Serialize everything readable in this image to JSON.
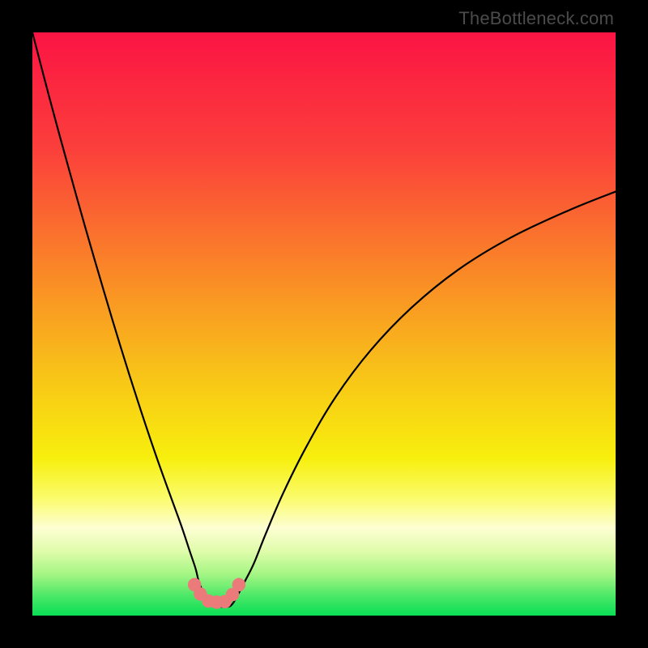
{
  "watermark": "TheBottleneck.com",
  "chart_data": {
    "type": "line",
    "title": "",
    "xlabel": "",
    "ylabel": "",
    "xlim": [
      0,
      100
    ],
    "ylim": [
      0,
      100
    ],
    "background_gradient": {
      "stops": [
        {
          "offset": 0,
          "color": "#fb1444"
        },
        {
          "offset": 20,
          "color": "#fb3f3b"
        },
        {
          "offset": 40,
          "color": "#fa8428"
        },
        {
          "offset": 60,
          "color": "#f8c817"
        },
        {
          "offset": 73,
          "color": "#f7ef0d"
        },
        {
          "offset": 80,
          "color": "#fbfc6e"
        },
        {
          "offset": 85,
          "color": "#fdfed3"
        },
        {
          "offset": 89,
          "color": "#dffcaa"
        },
        {
          "offset": 93,
          "color": "#a3f583"
        },
        {
          "offset": 96.5,
          "color": "#4ee868"
        },
        {
          "offset": 100,
          "color": "#09de55"
        }
      ]
    },
    "series": [
      {
        "name": "bottleneck-curve",
        "x": [
          0,
          3,
          6,
          9,
          12,
          15,
          18,
          21,
          23.5,
          25.5,
          27,
          28,
          28.5,
          29.4,
          30.5,
          32,
          33.5,
          34.3,
          35.2,
          36.5,
          38,
          40,
          43,
          47,
          52,
          58,
          65,
          73,
          82,
          92,
          100
        ],
        "y": [
          100,
          88.5,
          77.5,
          66.8,
          56.5,
          46.5,
          37,
          28,
          21,
          15.5,
          11,
          8,
          6,
          3.8,
          2.5,
          1.6,
          1.5,
          2,
          3.5,
          6,
          9,
          14,
          21,
          29,
          37.5,
          45.5,
          52.8,
          59.3,
          64.8,
          69.5,
          72.7
        ]
      }
    ],
    "markers": {
      "name": "valley-dots",
      "color": "#eb7b7b",
      "radius_pct": 1.15,
      "points": [
        {
          "x": 27.8,
          "y": 5.3
        },
        {
          "x": 28.8,
          "y": 3.7
        },
        {
          "x": 30.2,
          "y": 2.5
        },
        {
          "x": 31.6,
          "y": 2.3
        },
        {
          "x": 33.0,
          "y": 2.4
        },
        {
          "x": 34.3,
          "y": 3.6
        },
        {
          "x": 35.4,
          "y": 5.3
        }
      ]
    }
  }
}
